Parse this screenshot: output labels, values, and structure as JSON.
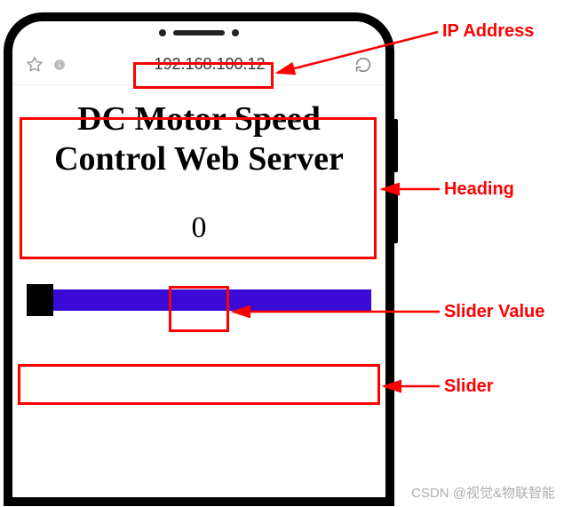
{
  "browser": {
    "url": "192.168.100.12"
  },
  "page": {
    "heading": "DC Motor Speed Control Web Server",
    "slider_value": "0"
  },
  "callouts": {
    "ip": "IP Address",
    "heading": "Heading",
    "value": "Slider Value",
    "slider": "Slider"
  },
  "watermark": "CSDN @视觉&物联智能"
}
